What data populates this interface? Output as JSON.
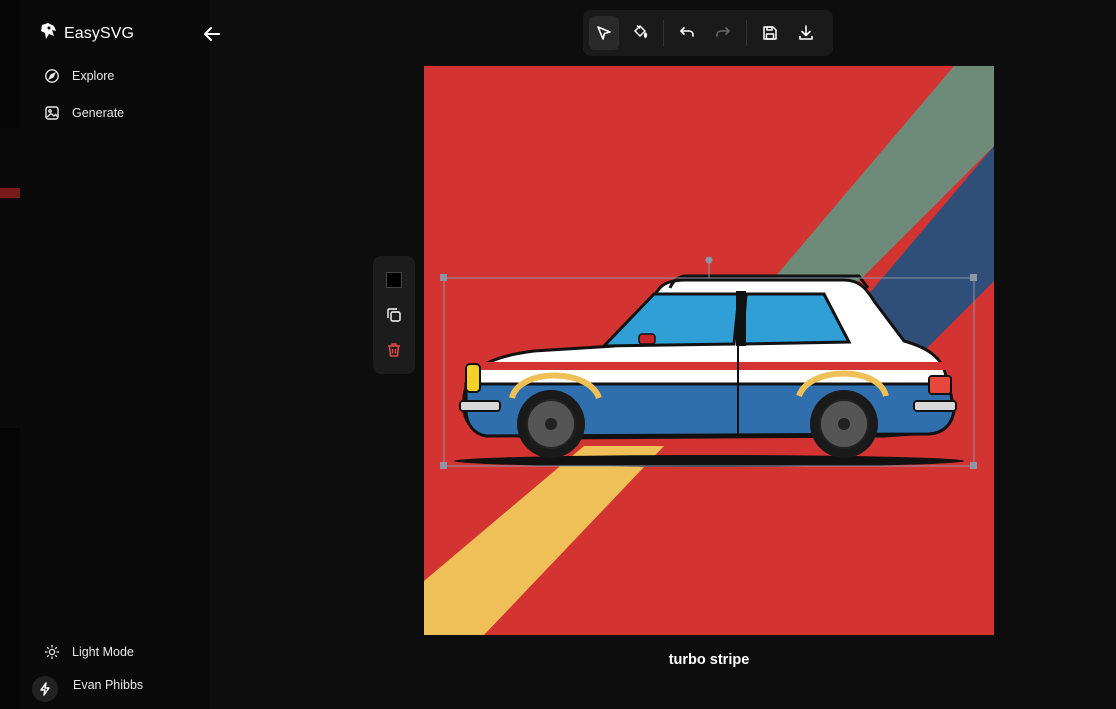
{
  "app": {
    "name": "EasySVG"
  },
  "sidebar": {
    "items": [
      {
        "label": "Explore",
        "icon": "compass-icon"
      },
      {
        "label": "Generate",
        "icon": "image-icon"
      }
    ],
    "footer": {
      "theme_label": "Light Mode",
      "user_name": "Evan Phibbs"
    }
  },
  "toolbar": {
    "tools": [
      "select-tool",
      "fill-tool",
      "undo",
      "redo",
      "save",
      "download"
    ],
    "active_tool": "select-tool"
  },
  "canvas": {
    "title": "turbo stripe",
    "background_color": "#d33431",
    "stripe_colors": [
      "#6e8a79",
      "#2f4f78",
      "#efbf58"
    ]
  },
  "selection_panel": {
    "actions": [
      "fill-color",
      "duplicate",
      "delete"
    ],
    "fill_color": "#000000"
  }
}
